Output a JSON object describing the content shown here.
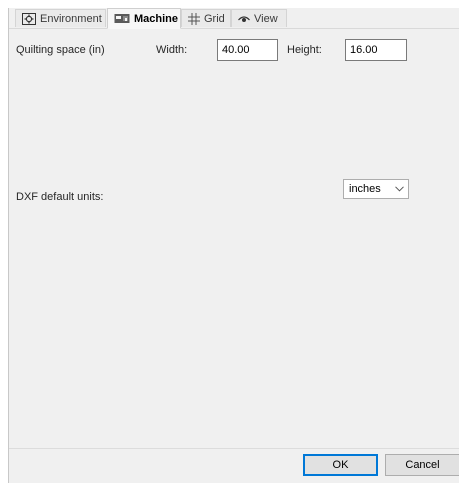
{
  "tabs": [
    {
      "label": "Environment",
      "icon": "gear-icon"
    },
    {
      "label": "Machine",
      "icon": "machine-icon"
    },
    {
      "label": "Grid",
      "icon": "grid-icon"
    },
    {
      "label": "View",
      "icon": "eye-icon"
    }
  ],
  "machine": {
    "quilting_space_label": "Quilting space (in)",
    "width_label": "Width:",
    "width_value": "40.00",
    "height_label": "Height:",
    "height_value": "16.00",
    "dxf_units_label": "DXF default units:",
    "dxf_units_selected": "inches"
  },
  "dialog": {
    "ok_label": "OK",
    "cancel_label": "Cancel"
  },
  "colors": {
    "accent": "#0078d7",
    "background": "#f0f0f0"
  }
}
